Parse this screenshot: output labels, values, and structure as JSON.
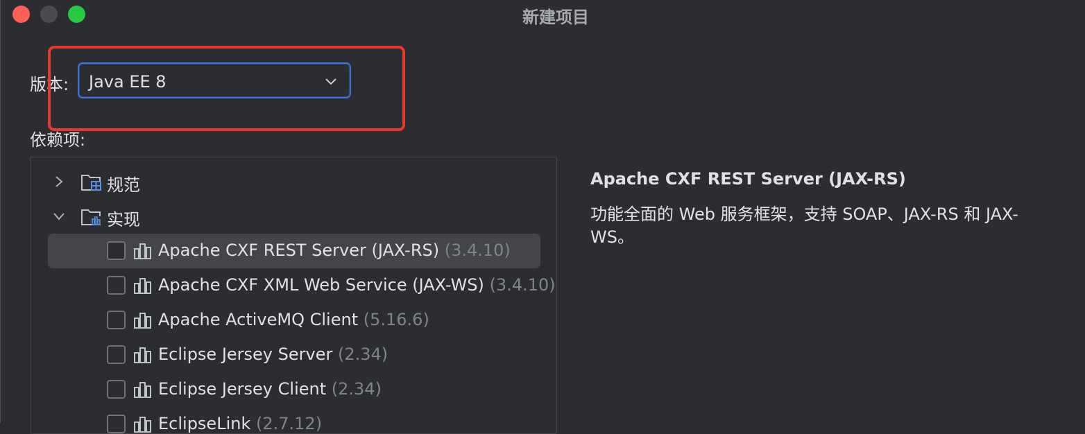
{
  "window": {
    "title": "新建项目"
  },
  "version": {
    "label": "版本:",
    "selected": "Java EE 8"
  },
  "dependencies": {
    "label": "依赖项:",
    "groups": [
      {
        "label": "规范",
        "expanded": false
      },
      {
        "label": "实现",
        "expanded": true
      }
    ],
    "items": [
      {
        "name": "Apache CXF REST Server (JAX-RS)",
        "version": "(3.4.10)",
        "checked": false,
        "selected": true
      },
      {
        "name": "Apache CXF XML Web Service (JAX-WS)",
        "version": "(3.4.10)",
        "checked": false,
        "selected": false
      },
      {
        "name": "Apache ActiveMQ Client",
        "version": "(5.16.6)",
        "checked": false,
        "selected": false
      },
      {
        "name": "Eclipse Jersey Server",
        "version": "(2.34)",
        "checked": false,
        "selected": false
      },
      {
        "name": "Eclipse Jersey Client",
        "version": "(2.34)",
        "checked": false,
        "selected": false
      },
      {
        "name": "EclipseLink",
        "version": "(2.7.12)",
        "checked": false,
        "selected": false
      }
    ]
  },
  "description": {
    "title": "Apache CXF REST Server (JAX-RS)",
    "text": "功能全面的 Web 服务框架，支持 SOAP、JAX-RS 和 JAX-WS。"
  },
  "colors": {
    "accent": "#3d74d6",
    "highlight": "#e8372b",
    "close": "#fe5f57",
    "maximize": "#28c840"
  },
  "icons": [
    "close-icon",
    "minimize-icon",
    "maximize-icon",
    "chevron-down-icon",
    "chevron-right-icon",
    "folder-spec-icon",
    "folder-impl-icon",
    "library-icon"
  ]
}
